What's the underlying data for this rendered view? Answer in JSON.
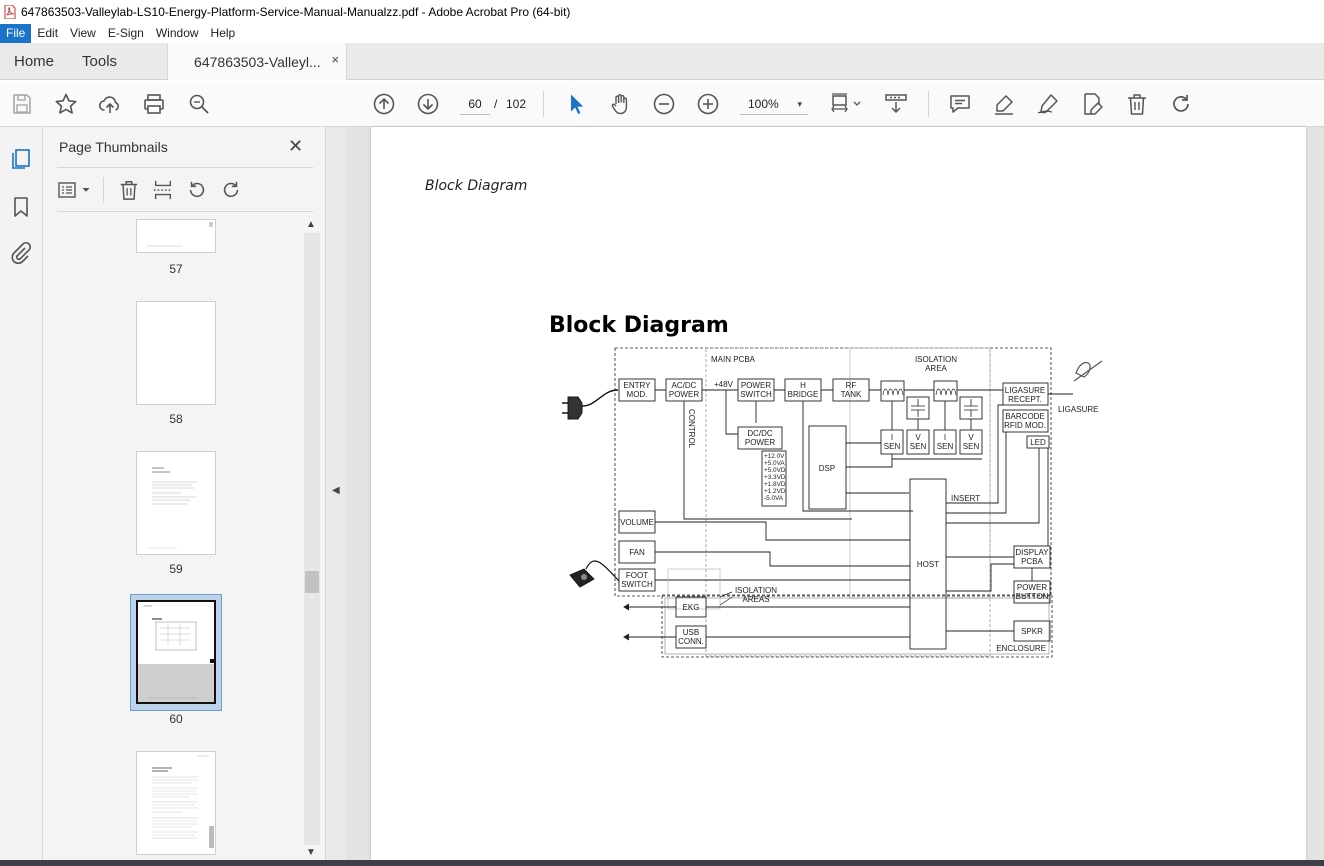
{
  "window": {
    "title": "647863503-Valleylab-LS10-Energy-Platform-Service-Manual-Manualzz.pdf - Adobe Acrobat Pro (64-bit)"
  },
  "menu": {
    "items": [
      {
        "label": "File",
        "active": true
      },
      {
        "label": "Edit"
      },
      {
        "label": "View"
      },
      {
        "label": "E-Sign"
      },
      {
        "label": "Window"
      },
      {
        "label": "Help"
      }
    ]
  },
  "tabs": {
    "home": "Home",
    "tools": "Tools",
    "document": "647863503-Valleyl...",
    "close": "×"
  },
  "toolbar": {
    "current_page": "60",
    "separator": "/",
    "total_pages": "102",
    "zoom": "100%",
    "zoom_caret": "▾"
  },
  "thumbnails": {
    "title": "Page Thumbnails",
    "close": "✕",
    "pages": [
      {
        "label": "57"
      },
      {
        "label": "58"
      },
      {
        "label": "59"
      },
      {
        "label": "60",
        "selected": true
      }
    ]
  },
  "document": {
    "running_header": "Block Diagram",
    "heading": "Block Diagram"
  },
  "diagram": {
    "main_pcba": "MAIN PCBA",
    "isolation_area_1": "ISOLATION",
    "isolation_area_2": "AREA",
    "entry_1": "ENTRY",
    "entry_2": "MOD.",
    "acdc_1": "AC/DC",
    "acdc_2": "POWER",
    "v48": "+48V",
    "pswitch_1": "POWER",
    "pswitch_2": "SWITCH",
    "hbridge_1": "H",
    "hbridge_2": "BRIDGE",
    "rftank_1": "RF",
    "rftank_2": "TANK",
    "ligasure_1": "LIGASURE",
    "ligasure_2": "RECEPT.",
    "ligasure_label": "LIGASURE",
    "barcode_1": "BARCODE",
    "barcode_2": "RFID MOD.",
    "led": "LED",
    "control": "CONTROL",
    "dcdc_1": "DC/DC",
    "dcdc_2": "POWER",
    "rail_1": "+12.0V",
    "rail_2": "+5.0VA",
    "rail_3": "+5.0VD",
    "rail_4": "+3.3VD",
    "rail_5": "+1.8VD",
    "rail_6": "+1.2VD",
    "rail_7": "-5.0VA",
    "dsp": "DSP",
    "isen_a_1": "I",
    "isen_a_2": "SEN",
    "vsen_a_1": "V",
    "vsen_a_2": "SEN",
    "isen_b_1": "I",
    "isen_b_2": "SEN",
    "vsen_b_1": "V",
    "vsen_b_2": "SEN",
    "insert": "INSERT",
    "volume": "VOLUME",
    "fan": "FAN",
    "foot_1": "FOOT",
    "foot_2": "SWITCH",
    "host": "HOST",
    "display_1": "DISPLAY",
    "display_2": "PCBA",
    "pbutton_1": "POWER",
    "pbutton_2": "BUTTON",
    "iso_areas_1": "ISOLATION",
    "iso_areas_2": "AREAS",
    "ekg": "EKG",
    "usb_1": "USB",
    "usb_2": "CONN.",
    "spkr": "SPKR",
    "enclosure": "ENCLOSURE"
  },
  "colors": {
    "menu_active": "#1a73c8",
    "selected_thumb": "#bcd3ea",
    "cursor_tool": "#1a73c8"
  }
}
